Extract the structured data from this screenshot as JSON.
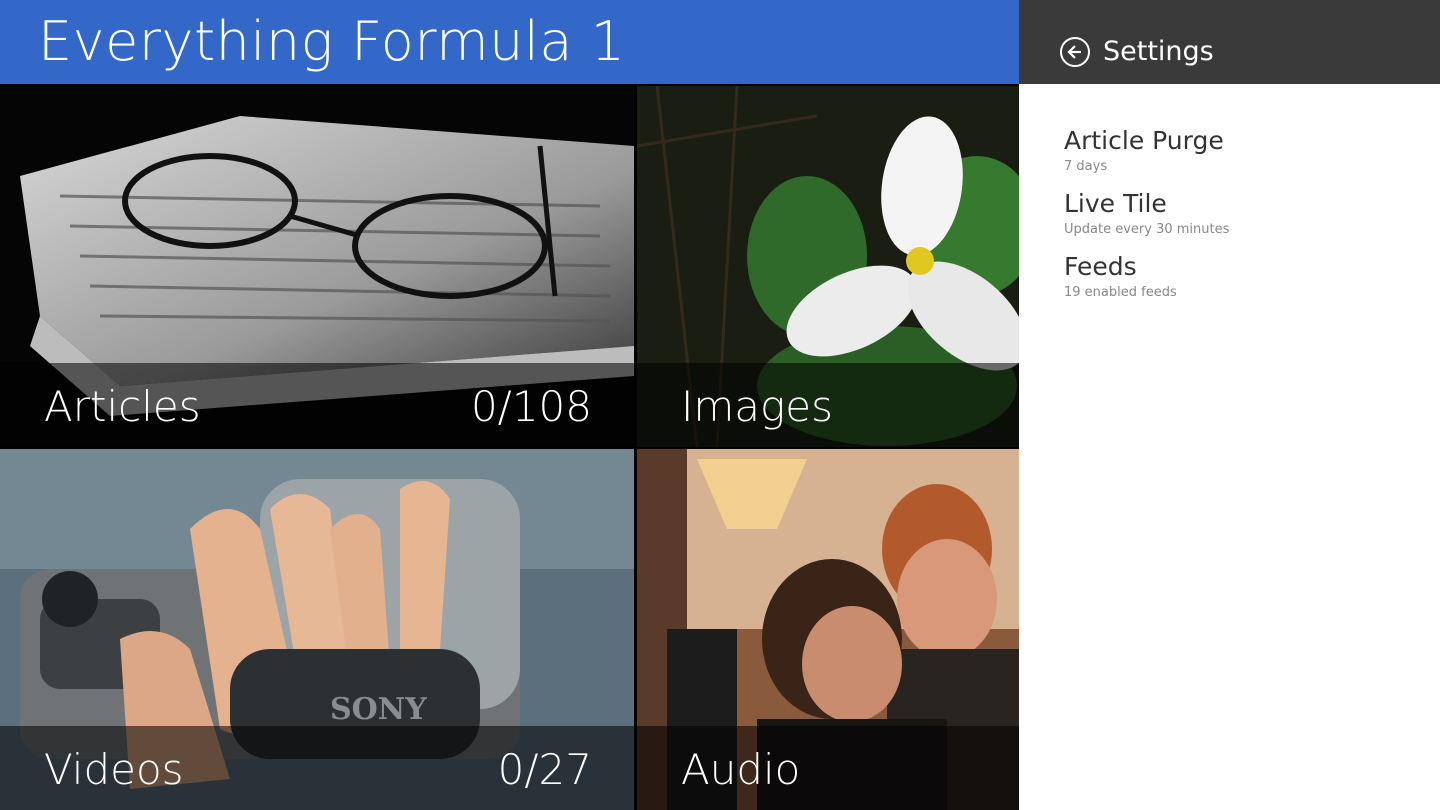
{
  "app": {
    "title": "Everything Formula 1"
  },
  "tiles": [
    {
      "label": "Articles",
      "count": "0/108"
    },
    {
      "label": "Images",
      "count": ""
    },
    {
      "label": "Videos",
      "count": "0/27"
    },
    {
      "label": "Audio",
      "count": ""
    }
  ],
  "settings": {
    "title": "Settings",
    "back_icon": "back-arrow-icon",
    "items": [
      {
        "name": "Article Purge",
        "value": "7 days"
      },
      {
        "name": "Live Tile",
        "value": "Update every 30 minutes"
      },
      {
        "name": "Feeds",
        "value": "19 enabled feeds"
      }
    ]
  },
  "colors": {
    "header_blue": "#3368c9",
    "settings_header": "#3a3a3a"
  }
}
